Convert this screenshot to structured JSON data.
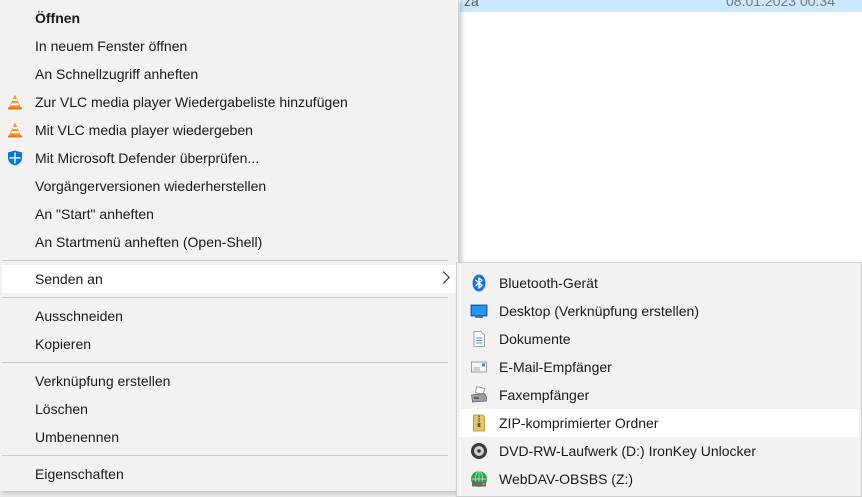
{
  "background": {
    "file_name": "za",
    "file_date": "08.01.2023 00:34"
  },
  "context_menu": {
    "items": [
      {
        "label": "Öffnen",
        "bold": true
      },
      {
        "label": "In neuem Fenster öffnen"
      },
      {
        "label": "An Schnellzugriff anheften"
      },
      {
        "label": "Zur VLC media player Wiedergabeliste hinzufügen",
        "icon": "vlc-icon"
      },
      {
        "label": "Mit VLC media player wiedergeben",
        "icon": "vlc-icon"
      },
      {
        "label": "Mit Microsoft Defender überprüfen...",
        "icon": "defender-shield-icon"
      },
      {
        "label": "Vorgängerversionen wiederherstellen"
      },
      {
        "label": "An \"Start\" anheften"
      },
      {
        "label": "An Startmenü anheften (Open-Shell)"
      },
      {
        "label": "Senden an",
        "has_submenu": true,
        "highlighted": true
      },
      {
        "label": "Ausschneiden"
      },
      {
        "label": "Kopieren"
      },
      {
        "label": "Verknüpfung erstellen"
      },
      {
        "label": "Löschen"
      },
      {
        "label": "Umbenennen"
      },
      {
        "label": "Eigenschaften"
      }
    ]
  },
  "send_to_submenu": {
    "items": [
      {
        "label": "Bluetooth-Gerät",
        "icon": "bluetooth-icon"
      },
      {
        "label": "Desktop (Verknüpfung erstellen)",
        "icon": "desktop-icon"
      },
      {
        "label": "Dokumente",
        "icon": "documents-icon"
      },
      {
        "label": "E-Mail-Empfänger",
        "icon": "mail-recipient-icon"
      },
      {
        "label": "Faxempfänger",
        "icon": "fax-icon"
      },
      {
        "label": "ZIP-komprimierter Ordner",
        "icon": "zip-folder-icon",
        "highlighted": true
      },
      {
        "label": "DVD-RW-Laufwerk (D:) IronKey Unlocker",
        "icon": "dvd-drive-icon"
      },
      {
        "label": "WebDAV-OBSBS (Z:)",
        "icon": "network-drive-icon"
      }
    ]
  },
  "colors": {
    "menu_background": "#f2f2f2",
    "hover_background": "#ffffff",
    "selection_blue": "#cce8ff",
    "vlc_orange": "#f7941d",
    "defender_blue": "#0078d4",
    "bluetooth_blue": "#1e73d8"
  }
}
